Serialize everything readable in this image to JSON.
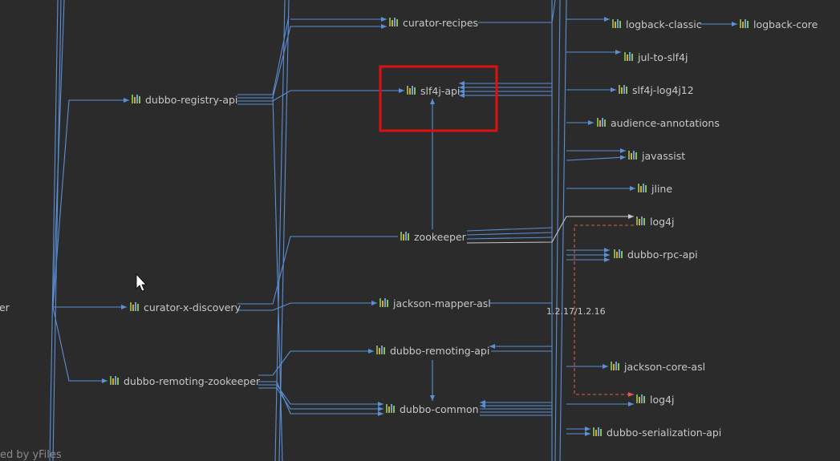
{
  "colors": {
    "background": "#2b2b2b",
    "edge": "#5b8fd6",
    "highlight": "#e01010",
    "conflict": "#e05a4f",
    "text": "#c8c8c8"
  },
  "nodes": {
    "curator_recipes": "curator-recipes",
    "logback_classic": "logback-classic",
    "logback_core": "logback-core",
    "jul_to_slf4j": "jul-to-slf4j",
    "dubbo_registry_api": "dubbo-registry-api",
    "slf4j_api": "slf4j-api",
    "slf4j_log4j12": "slf4j-log4j12",
    "audience_annotations": "audience-annotations",
    "javassist": "javassist",
    "jline": "jline",
    "log4j_top": "log4j",
    "zookeeper_mid": "zookeeper",
    "dubbo_rpc_api": "dubbo-rpc-api",
    "zookeeper_left": "zookeeper",
    "curator_x_discovery": "curator-x-discovery",
    "jackson_mapper_asl": "jackson-mapper-asl",
    "dubbo_remoting_api": "dubbo-remoting-api",
    "jackson_core_asl": "jackson-core-asl",
    "dubbo_remoting_zookeeper": "dubbo-remoting-zookeeper",
    "log4j_bottom": "log4j",
    "dubbo_common": "dubbo-common",
    "dubbo_serialization_api": "dubbo-serialization-api"
  },
  "version_label": "1.2.17/1.2.16",
  "watermark": "ed by yFiles"
}
